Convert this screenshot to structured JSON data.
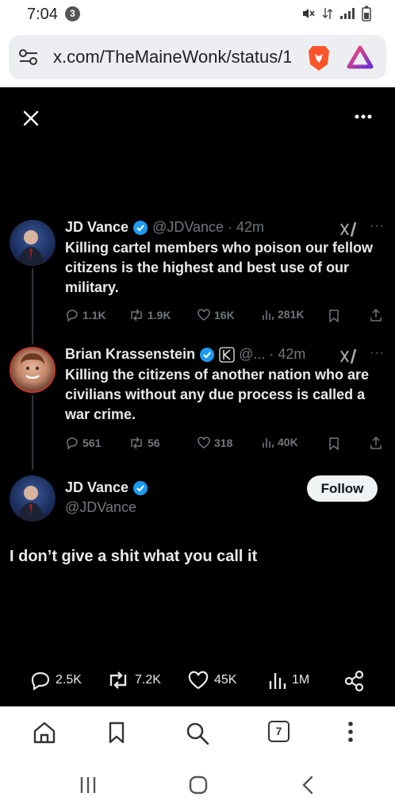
{
  "status_bar": {
    "time": "7:04",
    "notification_count": "3"
  },
  "address_bar": {
    "url": "x.com/TheMaineWonk/status/1"
  },
  "tweets": [
    {
      "name": "JD Vance",
      "handle_time": "@JDVance · 42m",
      "text": "Killing cartel members who poison our fellow citizens is the highest and best use of our military.",
      "replies": "1.1K",
      "reposts": "1.9K",
      "likes": "16K",
      "views": "281K"
    },
    {
      "name": "Brian Krassenstein",
      "handle_time": "@... · 42m",
      "text": "Killing the citizens of another nation who are civilians without any due process is called a war crime.",
      "replies": "561",
      "reposts": "56",
      "likes": "318",
      "views": "40K"
    }
  ],
  "main_tweet": {
    "name": "JD Vance",
    "handle": "@JDVance",
    "follow_label": "Follow",
    "text": "I don’t give a shit what you call it",
    "replies": "2.5K",
    "reposts": "7.2K",
    "likes": "45K",
    "views": "1M"
  },
  "browser_toolbar": {
    "tab_count": "7"
  },
  "colors": {
    "verified": "#1d9bf0",
    "background": "#000000",
    "muted": "#71767b"
  },
  "icons": [
    "close-icon",
    "more-icon",
    "grok-icon",
    "reply-icon",
    "repost-icon",
    "like-icon",
    "views-icon",
    "bookmark-icon",
    "share-icon",
    "home-icon",
    "search-icon",
    "recents-icon",
    "back-icon"
  ]
}
